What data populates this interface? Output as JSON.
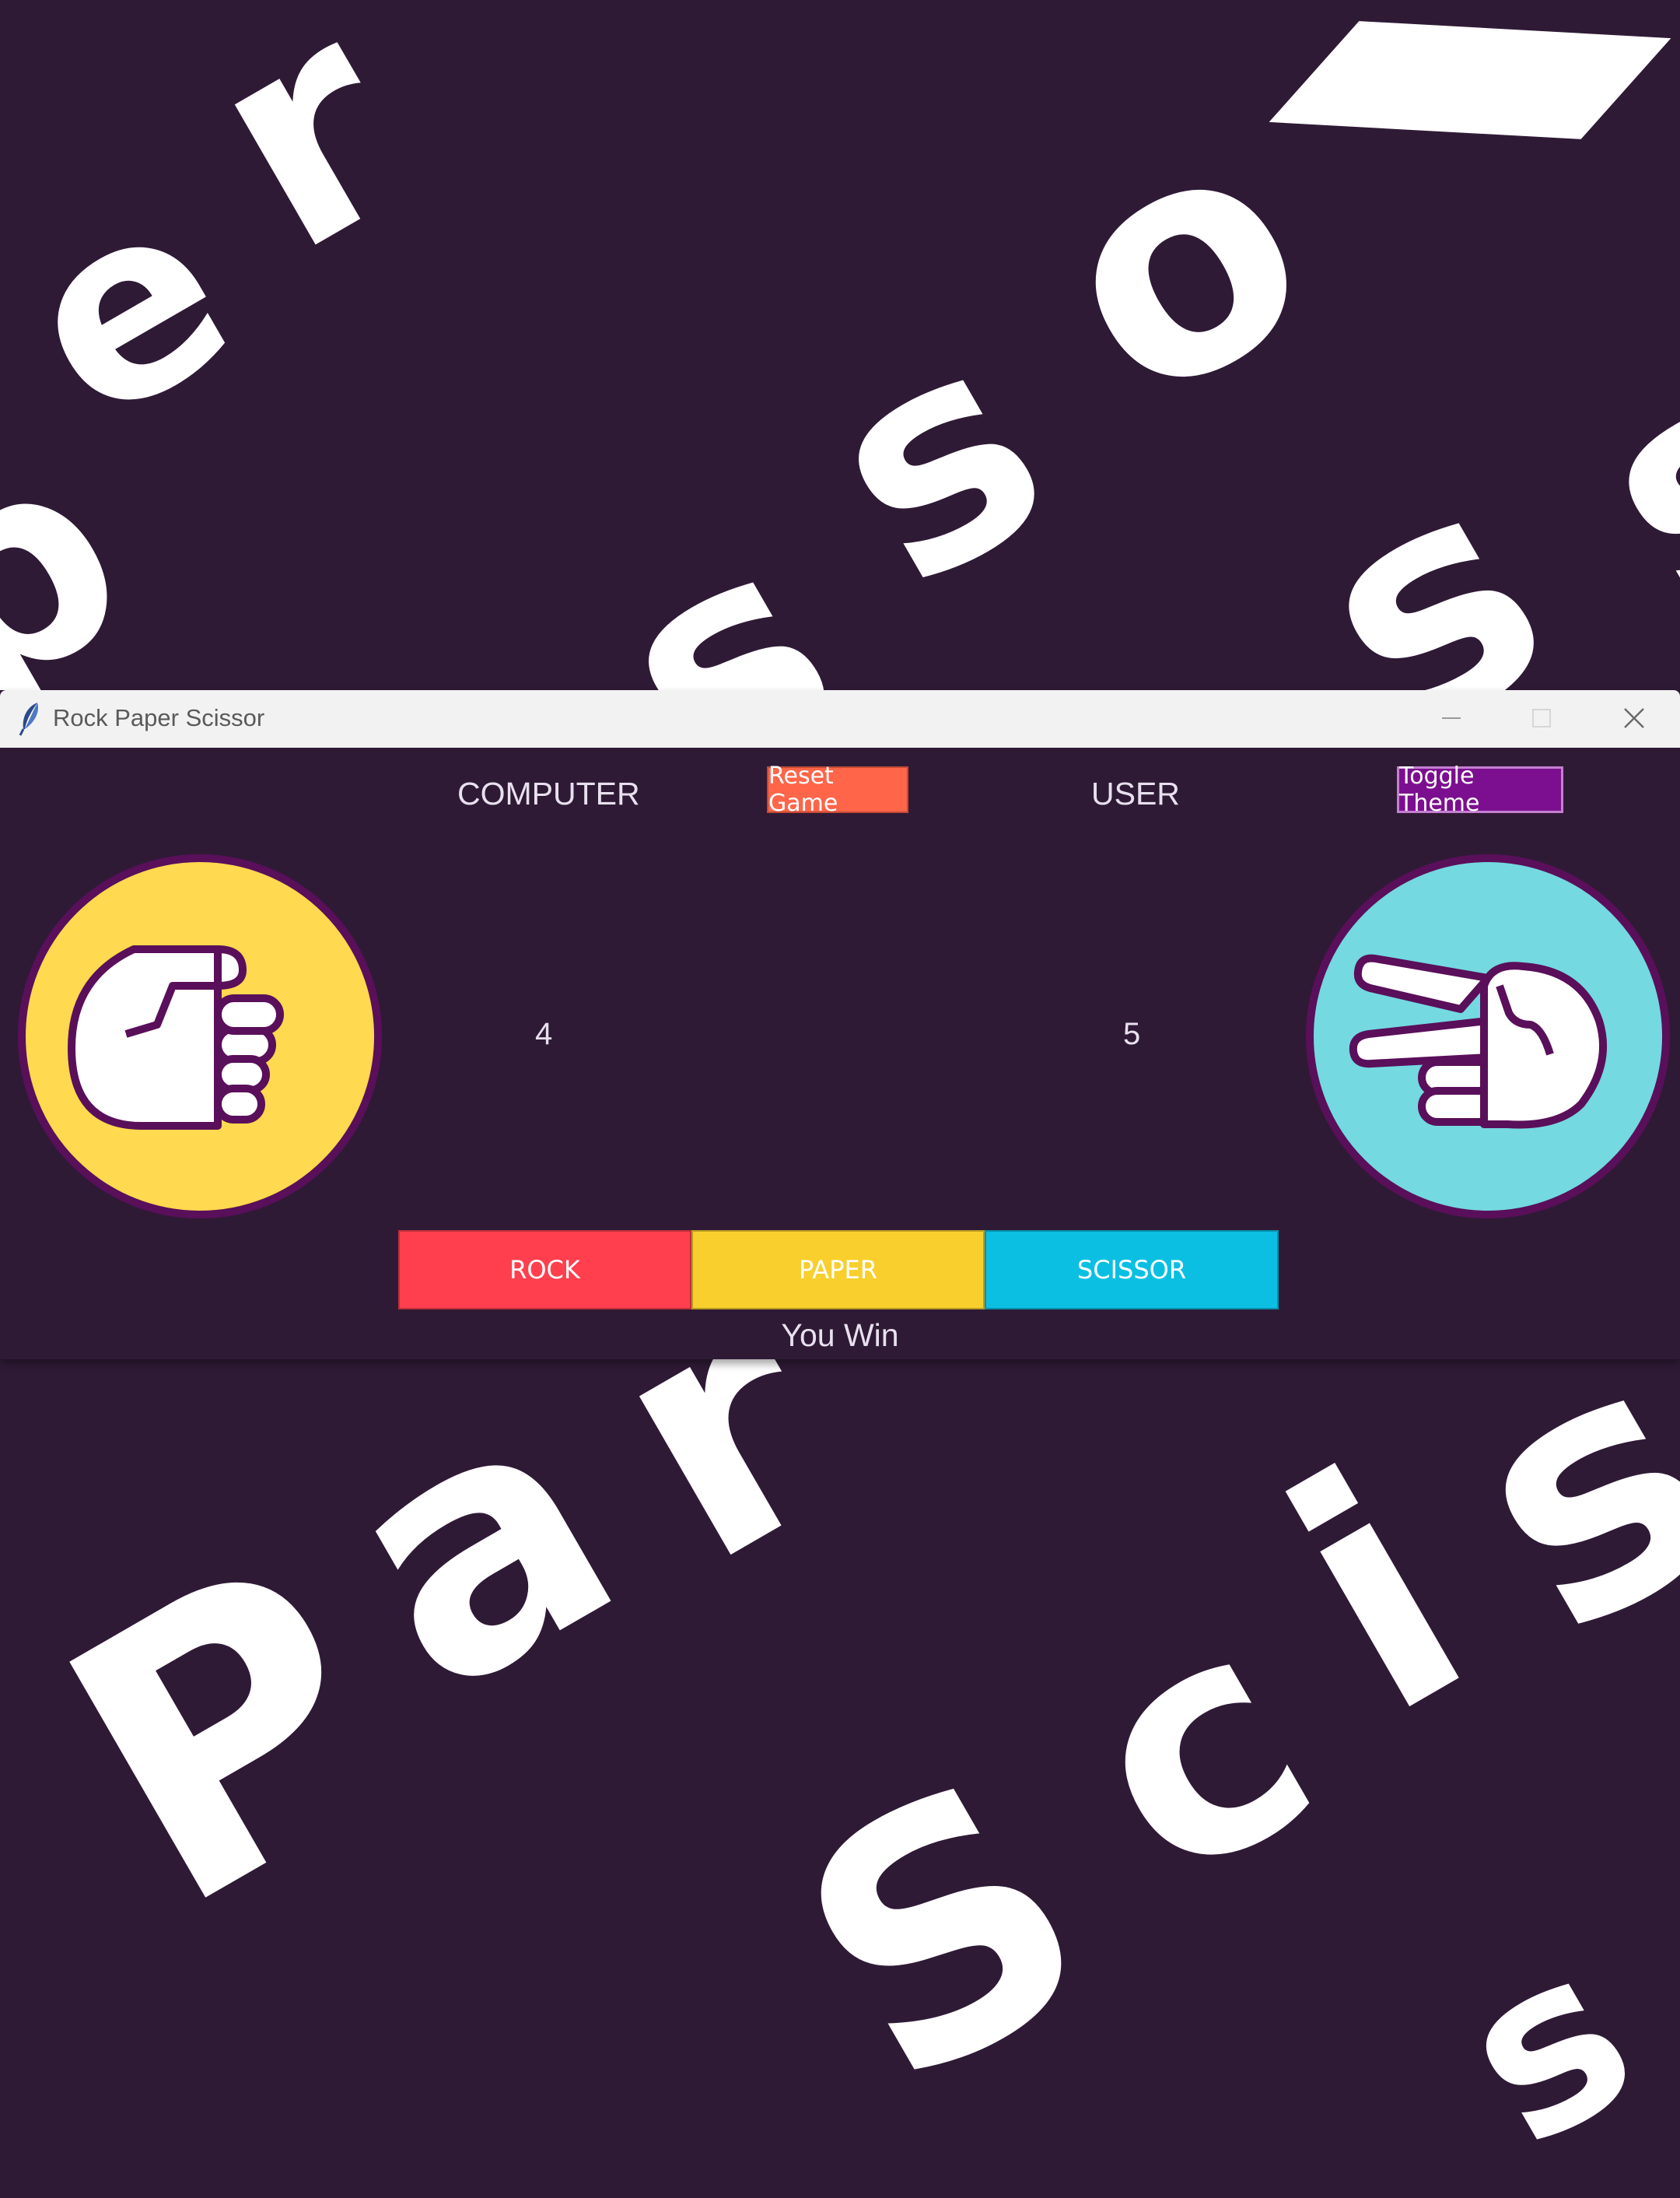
{
  "background": {
    "color": "#2f1a36",
    "letters_top": [
      "e",
      "r",
      "o",
      "s",
      "s",
      "s",
      "s"
    ],
    "letters_bottom": [
      "P",
      "a",
      "r",
      "S",
      "c",
      "i",
      "s"
    ]
  },
  "window": {
    "title": "Rock Paper Scissor",
    "controls": {
      "minimize_icon": "minimize-icon",
      "maximize_icon": "maximize-icon",
      "close_icon": "close-icon"
    }
  },
  "header": {
    "computer_label": "COMPUTER",
    "reset_label": "Reset Game",
    "user_label": "USER",
    "toggle_label": "Toggle Theme"
  },
  "game": {
    "computer_choice_icon": "paper-hand-icon",
    "user_choice_icon": "scissor-hand-icon",
    "computer_score": "4",
    "user_score": "5",
    "result": "You Win"
  },
  "choices": {
    "rock": "ROCK",
    "paper": "PAPER",
    "scissor": "SCISSOR"
  },
  "colors": {
    "reset_button": "#fe6549",
    "toggle_button": "#7c0f8f",
    "rock": "#ff3f4d",
    "paper": "#f8cf2d",
    "scissor": "#0bbfe3",
    "computer_circle": "#ffd94f",
    "user_circle": "#74d9e1"
  }
}
